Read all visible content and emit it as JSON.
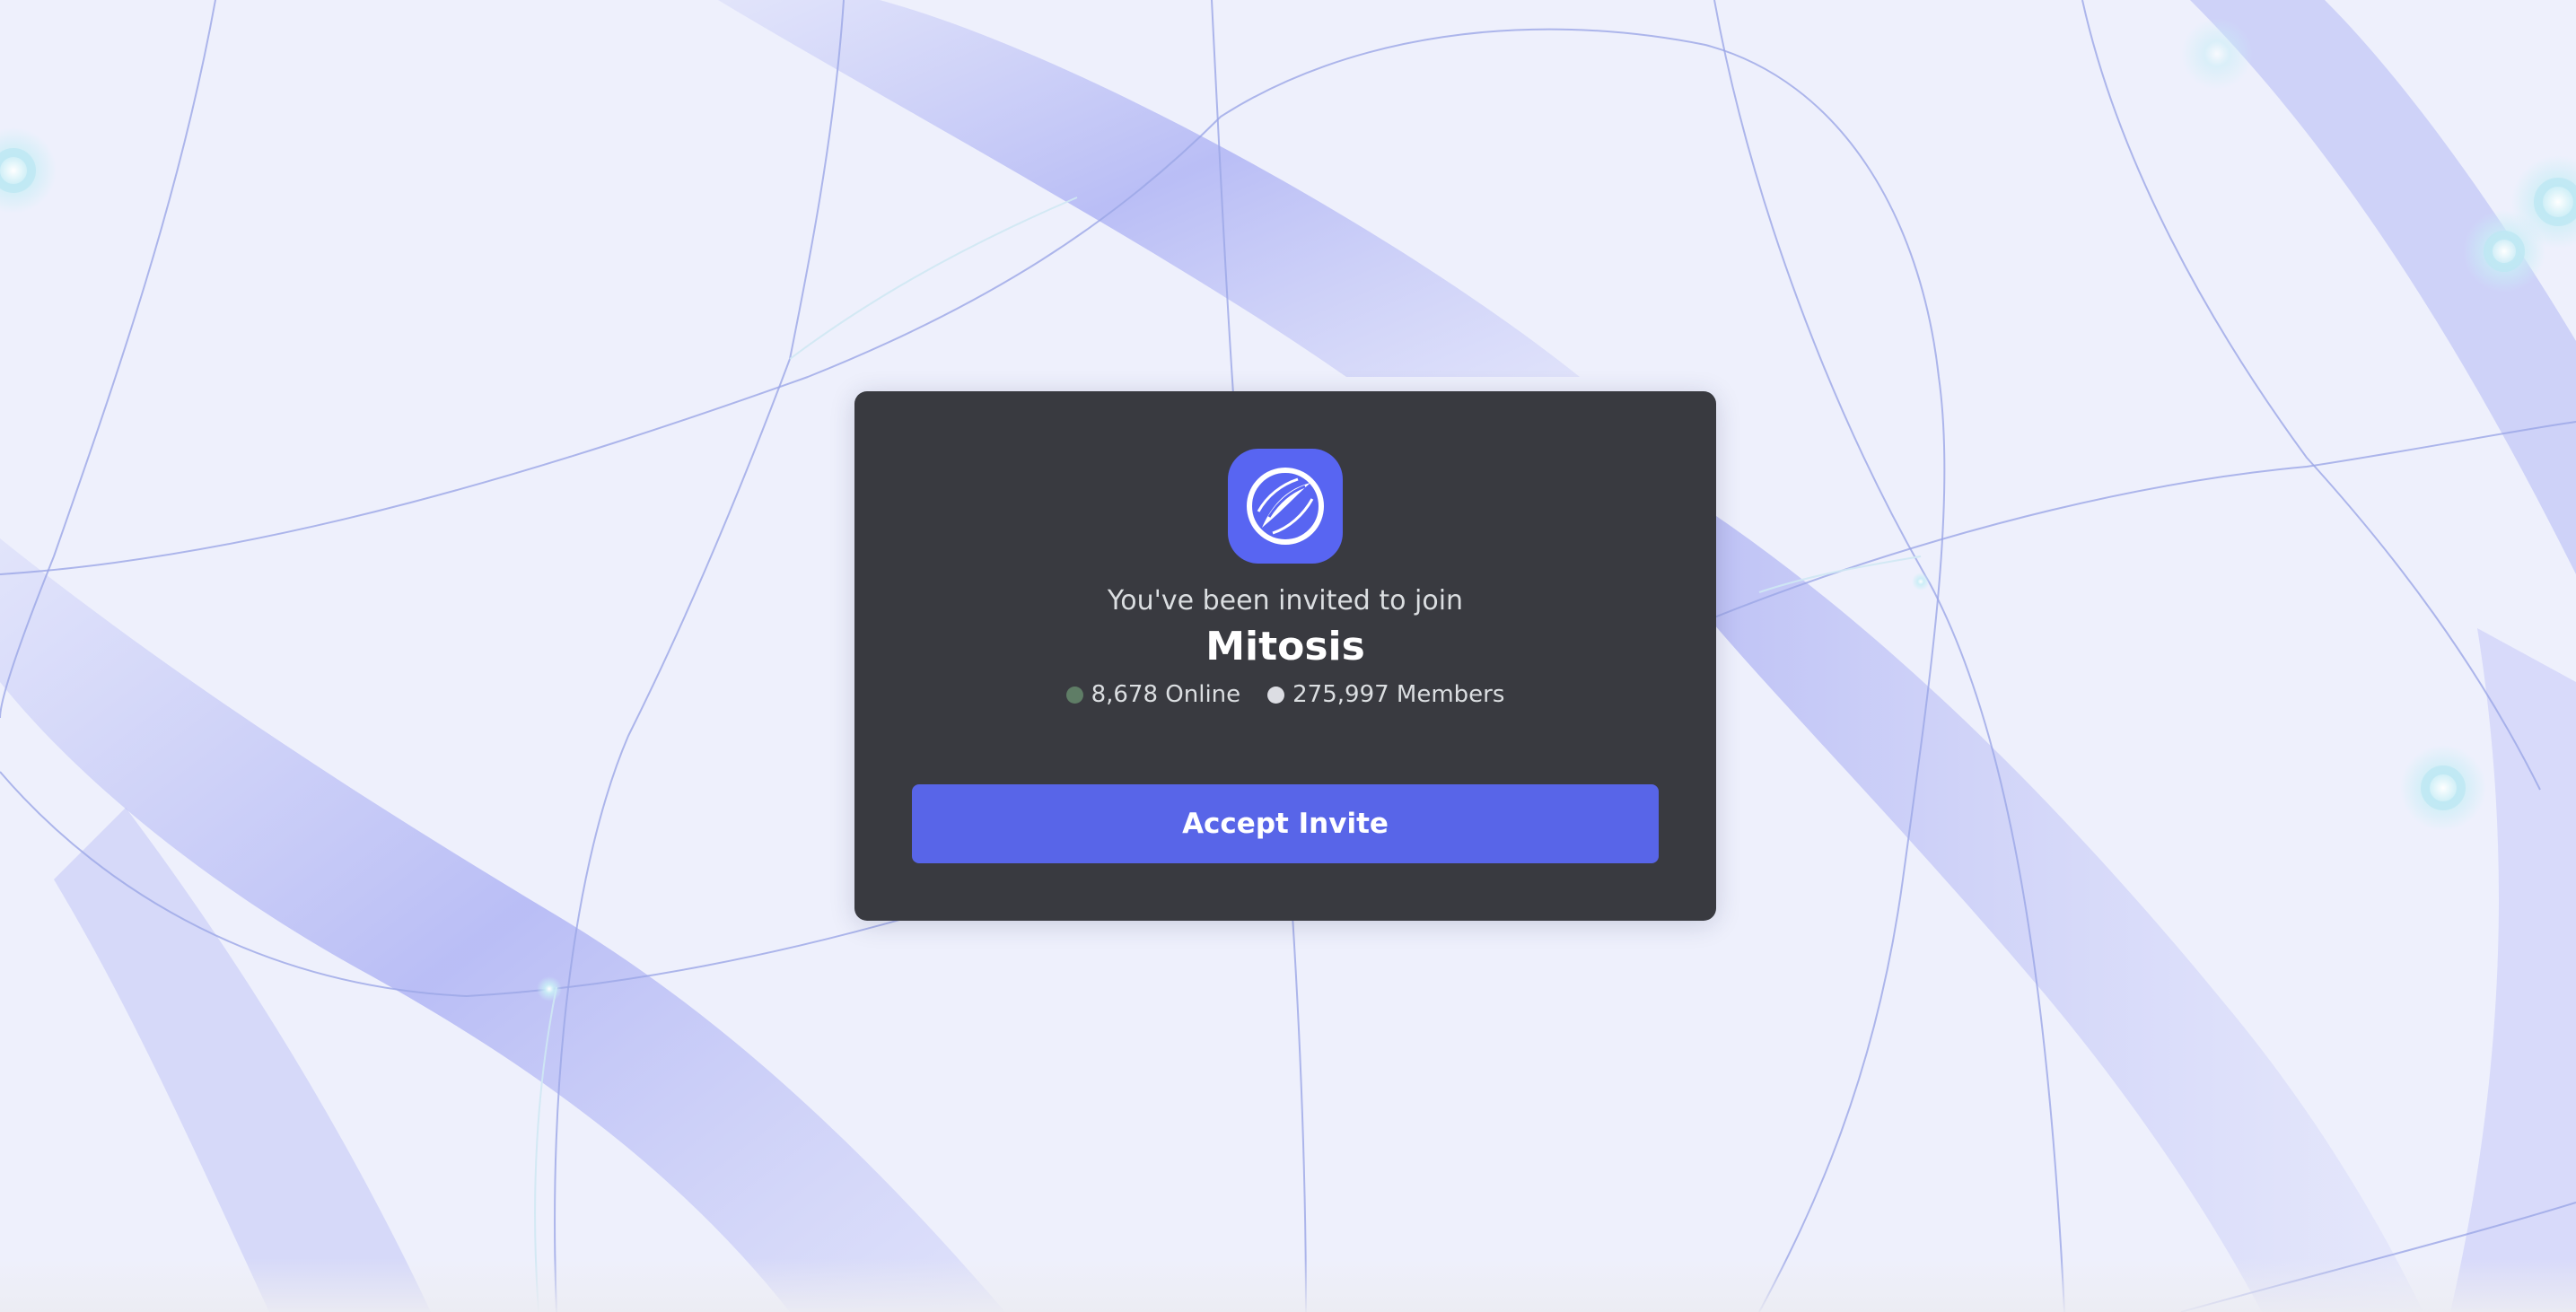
{
  "invite": {
    "subtitle": "You've been invited to join",
    "server_name": "Mitosis",
    "server_icon": "mitosis-logo-icon",
    "online_count": "8,678 Online",
    "member_count": "275,997 Members",
    "accept_label": "Accept Invite"
  },
  "colors": {
    "background": "#edf0fd",
    "card": "#393a40",
    "accent": "#5865f2",
    "online_dot": "#5f7d66",
    "member_dot": "#dcdde3"
  }
}
